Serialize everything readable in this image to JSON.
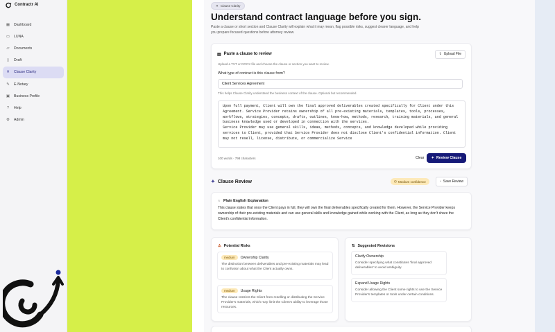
{
  "app": {
    "name": "Contractr AI"
  },
  "sidebar": {
    "items": [
      {
        "label": "Dashboard",
        "icon": "grid-icon"
      },
      {
        "label": "LUNA",
        "icon": "chat-icon"
      },
      {
        "label": "Documents",
        "icon": "folder-icon"
      },
      {
        "label": "Draft",
        "icon": "file-icon"
      },
      {
        "label": "Clause Clarity",
        "icon": "sparkle-icon",
        "active": true
      },
      {
        "label": "E-Notary",
        "icon": "pen-icon"
      },
      {
        "label": "Business Profile",
        "icon": "briefcase-icon"
      },
      {
        "label": "Help",
        "icon": "help-icon"
      },
      {
        "label": "Admin",
        "icon": "settings-icon"
      }
    ]
  },
  "header": {
    "pill": "Clause Clarity",
    "title": "Understand contract language before you sign.",
    "description": "Paste a clause or short section and Clause Clarity will explain what it may mean, flag possible risks, suggest clearer language, and help you prepare focused questions before attorney review."
  },
  "paste_card": {
    "title": "Paste a clause to review",
    "upload_label": "Upload File",
    "upload_hint": "Upload a TXT or DOCX file and choose the clause or section you want to review.",
    "contract_type_label": "What type of contract is this clause from?",
    "contract_type_value": "Client Services Agreement",
    "contract_type_hint": "This helps Clause Clarity understand the business context of the clause. Optional but recommended.",
    "clause_text": "Upon full payment, Client will own the final approved deliverables created specifically for Client under this Agreement. Service Provider retains ownership of all pre-existing materials, templates, tools, processes, workflows, strategies, concepts, drafts, outlines, know-how, methods, research, training materials, and general business knowledge used or developed in connection with the services.\nService Provider may use general skills, ideas, methods, concepts, and knowledge developed while providing services to Client, provided that Service Provider does not disclose Client's confidential information. Client may not resell, license, distribute, or commercialize Service",
    "counts": "100 words · 798 characters",
    "clear_label": "Clear",
    "review_label": "Review Clause"
  },
  "review": {
    "title": "Clause Review",
    "confidence": "Medium confidence",
    "save_label": "Save Review",
    "explanation_title": "Plain English Explanation",
    "explanation": "This clause states that once the Client pays in full, they will own the final deliverables specifically created for them. However, the Service Provider keeps ownership of their pre-existing materials and can use general skills and knowledge gained while working with the Client, as long as they don't share the Client's confidential information.",
    "risks_title": "Potential Risks",
    "risks": [
      {
        "level": "medium",
        "title": "Ownership Clarity",
        "desc": "The distinction between deliverables and pre-existing materials may lead to confusion about what the Client actually owns."
      },
      {
        "level": "medium",
        "title": "Usage Rights",
        "desc": "The clause restricts the Client from reselling or distributing the Service Provider's materials, which may limit the Client's ability to leverage those resources."
      }
    ],
    "revisions_title": "Suggested Revisions",
    "revisions": [
      {
        "title": "Clarify Ownership",
        "desc": "Consider specifying what constitutes 'final approved deliverables' to avoid ambiguity."
      },
      {
        "title": "Expand Usage Rights",
        "desc": "Consider allowing the Client some rights to use the Service Provider's templates or tools under certain conditions."
      }
    ]
  },
  "colors": {
    "accent": "#161a78",
    "lime": "#d6ef49",
    "badge": "#fde9b8"
  }
}
